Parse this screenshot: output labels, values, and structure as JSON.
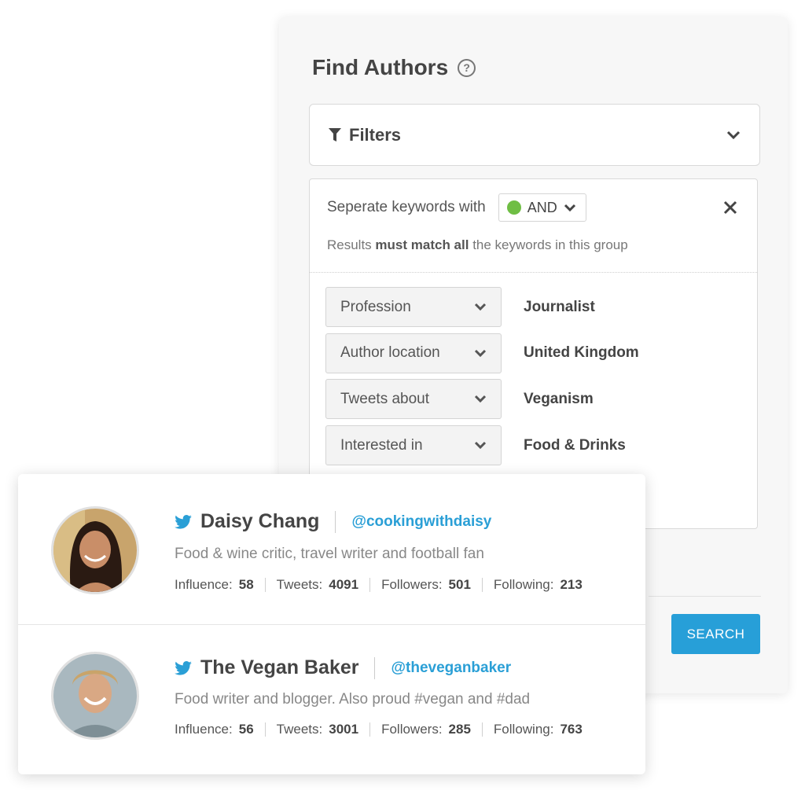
{
  "panel": {
    "title": "Find Authors",
    "filters_label": "Filters",
    "keyword_label": "Seperate keywords with",
    "operator": "AND",
    "operator_color": "#6fbe44",
    "note_prefix": "Results",
    "note_bold": "must match all",
    "note_suffix": "the keywords in this group",
    "criteria": [
      {
        "field": "Profession",
        "value": "Journalist"
      },
      {
        "field": "Author location",
        "value": "United Kingdom"
      },
      {
        "field": "Tweets about",
        "value": "Veganism"
      },
      {
        "field": "Interested in",
        "value": "Food & Drinks"
      }
    ],
    "search_label": "SEARCH",
    "accent": "#279fd8"
  },
  "authors": [
    {
      "name": "Daisy Chang",
      "handle": "@cookingwithdaisy",
      "bio": "Food & wine critic, travel writer and football fan",
      "stats": [
        {
          "label": "Influence:",
          "value": "58"
        },
        {
          "label": "Tweets:",
          "value": "4091"
        },
        {
          "label": "Followers:",
          "value": "501"
        },
        {
          "label": "Following:",
          "value": "213"
        }
      ]
    },
    {
      "name": "The Vegan Baker",
      "handle": "@theveganbaker",
      "bio": "Food writer and blogger. Also proud #vegan and #dad",
      "stats": [
        {
          "label": "Influence:",
          "value": "56"
        },
        {
          "label": "Tweets:",
          "value": "3001"
        },
        {
          "label": "Followers:",
          "value": "285"
        },
        {
          "label": "Following:",
          "value": "763"
        }
      ]
    }
  ]
}
